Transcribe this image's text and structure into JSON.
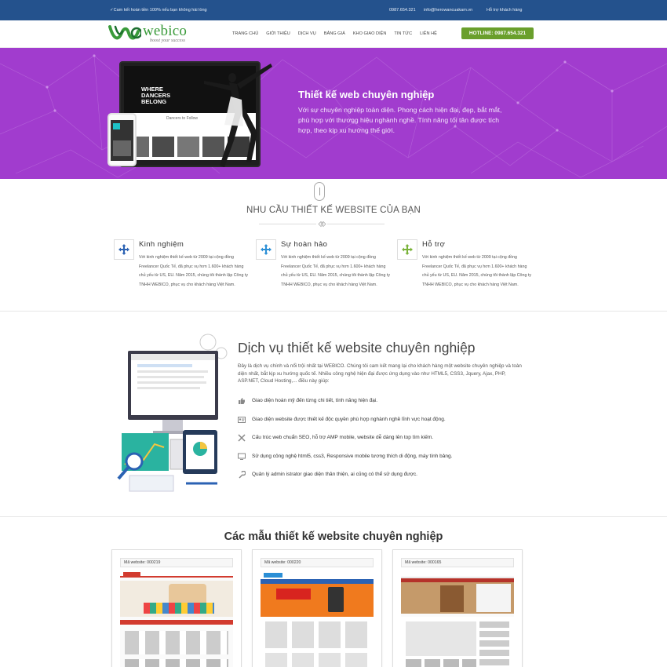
{
  "topbar": {
    "promise": "✓Cam kết hoàn tiền 100% nếu bạn không hài lòng",
    "phone": "0987.654.321",
    "email": "info@herowancuakam.vn",
    "support": "Hỗ trợ khách hàng"
  },
  "header": {
    "logo_text": "webico",
    "slogan": "boost your success",
    "nav": [
      "Trang chủ",
      "Giới thiệu",
      "Dịch vụ",
      "Bảng giá",
      "Kho giao diện",
      "Tin tức",
      "Liên hệ"
    ],
    "hotline": "HOTLINE: 0987.654.321"
  },
  "hero": {
    "title": "Thiết kế web chuyên nghiệp",
    "text": "Với sự chuyên nghiệp toàn diện. Phong cách hiện đại, đẹp, bắt mắt, phù hợp với thương hiệu nghành nghề. Tính năng tối tân được tích hợp, theo kịp xu hướng thế giới.",
    "mockup_heading": "WHERE DANCERS BELONG",
    "mockup_sub": "Dancers to Follow",
    "background_color": "#a13cce"
  },
  "needs": {
    "title": "Nhu cầu thiết kế website của bạn",
    "features": [
      {
        "icon": "move-arrows-icon",
        "color": "#2b62b3",
        "title": "Kinh nghiệm",
        "text": "Với kinh nghiệm thiết kế web từ 2009 tại cộng đồng Freelancer Quốc Tế, đã phục vụ hơn 1.600+ khách hàng chủ yếu từ US, EU. Năm 2015, chúng tôi thành lập Công ty TNHH WEBICO, phục vụ cho khách hàng Việt Nam."
      },
      {
        "icon": "move-arrows-icon",
        "color": "#2b8fd6",
        "title": "Sự hoàn hảo",
        "text": "Với kinh nghiệm thiết kế web từ 2009 tại cộng đồng Freelancer Quốc Tế, đã phục vụ hơn 1.600+ khách hàng chủ yếu từ US, EU. Năm 2015, chúng tôi thành lập Công ty TNHH WEBICO, phục vụ cho khách hàng Việt Nam."
      },
      {
        "icon": "move-arrows-icon",
        "color": "#7ab33a",
        "title": "Hỗ trợ",
        "text": "Với kinh nghiệm thiết kế web từ 2009 tại cộng đồng Freelancer Quốc Tế, đã phục vụ hơn 1.600+ khách hàng chủ yếu từ US, EU. Năm 2015, chúng tôi thành lập Công ty TNHH WEBICO, phục vụ cho khách hàng Việt Nam."
      }
    ]
  },
  "service": {
    "title": "Dịch vụ thiết kế website chuyên nghiệp",
    "intro": "Đây là dịch vụ chính và nổi trội nhất tại WEBICO. Chúng tôi cam kết mang lại cho khách hàng một website chuyên nghiệp và toàn diện nhất, bắt kịp xu hướng quốc tế. Nhiều công nghệ hiện đại được ứng dụng vào như HTML5, CSS3, Jquery, Ajax, PHP, ASP.NET, Cloud Hosting,... điều này giúp:",
    "items": [
      {
        "icon": "thumbs-up-icon",
        "text": "Giao diện hoàn mỹ đến từng chi tiết, tính năng hiện đại."
      },
      {
        "icon": "id-card-icon",
        "text": "Giao diện website được thiết kế độc quyền phù hợp nghành nghề lĩnh vực hoạt động."
      },
      {
        "icon": "tools-icon",
        "text": "Cấu trúc web chuẩn SEO, hỗ trợ AMP mobile, website dễ dàng lên top tìm kiếm."
      },
      {
        "icon": "monitor-icon",
        "text": "Sử dụng công nghệ html5, css3, Responsive mobile tương thích di động, máy tính bảng."
      },
      {
        "icon": "wrench-icon",
        "text": "Quản lý admin istrator giao diện thân thiện, ai cũng có thể sử dụng được."
      }
    ]
  },
  "templates": {
    "title": "Các mẫu thiết kế website chuyên nghiệp",
    "cards": [
      {
        "code": "Mã website: 000219"
      },
      {
        "code": "Mã website: 000220"
      },
      {
        "code": "Mã website: 000165"
      }
    ]
  }
}
